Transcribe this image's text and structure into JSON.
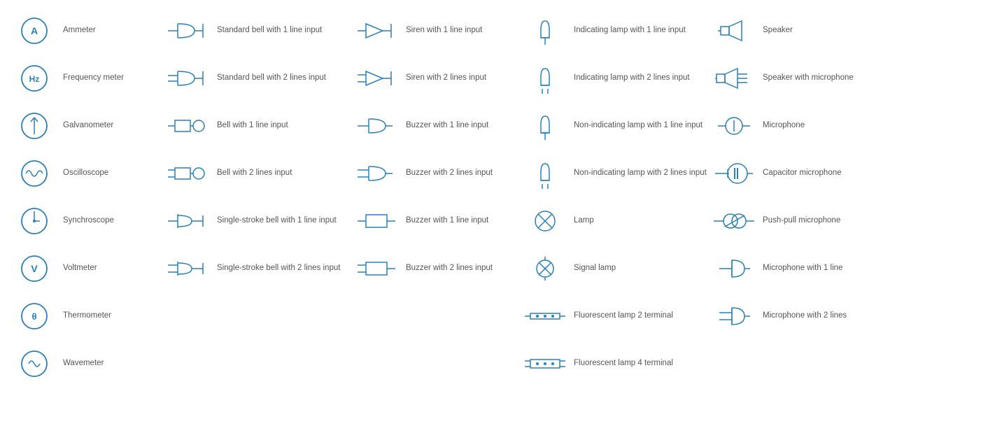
{
  "columns": [
    {
      "id": "meters",
      "items": [
        {
          "id": "ammeter",
          "label": "Ammeter",
          "symbol": "ammeter"
        },
        {
          "id": "frequency-meter",
          "label": "Frequency meter",
          "symbol": "frequency"
        },
        {
          "id": "galvanometer",
          "label": "Galvanometer",
          "symbol": "galvanometer"
        },
        {
          "id": "oscilloscope",
          "label": "Oscilloscope",
          "symbol": "oscilloscope"
        },
        {
          "id": "synchroscope",
          "label": "Synchroscope",
          "symbol": "synchroscope"
        },
        {
          "id": "voltmeter",
          "label": "Voltmeter",
          "symbol": "voltmeter"
        },
        {
          "id": "thermometer",
          "label": "Thermometer",
          "symbol": "thermometer"
        },
        {
          "id": "wavemeter",
          "label": "Wavemeter",
          "symbol": "wavemeter"
        }
      ]
    },
    {
      "id": "bells",
      "items": [
        {
          "id": "std-bell-1",
          "label": "Standard bell with 1 line input",
          "symbol": "std-bell-1"
        },
        {
          "id": "std-bell-2",
          "label": "Standard bell with 2 lines input",
          "symbol": "std-bell-2"
        },
        {
          "id": "bell-1",
          "label": "Bell with 1 line input",
          "symbol": "bell-1"
        },
        {
          "id": "bell-2",
          "label": "Bell with 2 lines input",
          "symbol": "bell-2"
        },
        {
          "id": "single-stroke-bell-1",
          "label": "Single-stroke bell with 1 line input",
          "symbol": "single-stroke-bell-1"
        },
        {
          "id": "single-stroke-bell-2",
          "label": "Single-stroke bell with 2 lines input",
          "symbol": "single-stroke-bell-2"
        }
      ]
    },
    {
      "id": "sirens",
      "items": [
        {
          "id": "siren-1",
          "label": "Siren with 1 line input",
          "symbol": "siren-1"
        },
        {
          "id": "siren-2",
          "label": "Siren with 2 lines input",
          "symbol": "siren-2"
        },
        {
          "id": "buzzer-1",
          "label": "Buzzer with 1 line input",
          "symbol": "buzzer-1"
        },
        {
          "id": "buzzer-2",
          "label": "Buzzer with 2 lines input",
          "symbol": "buzzer-2"
        },
        {
          "id": "buzzer-box-1",
          "label": "Buzzer with 1 line input",
          "symbol": "buzzer-box-1"
        },
        {
          "id": "buzzer-box-2",
          "label": "Buzzer with 2 lines input",
          "symbol": "buzzer-box-2"
        }
      ]
    },
    {
      "id": "lamps",
      "items": [
        {
          "id": "ind-lamp-1",
          "label": "Indicating lamp with 1 line input",
          "symbol": "ind-lamp-1"
        },
        {
          "id": "ind-lamp-2",
          "label": "Indicating lamp with 2 lines input",
          "symbol": "ind-lamp-2"
        },
        {
          "id": "non-ind-lamp-1",
          "label": "Non-indicating lamp with 1 line input",
          "symbol": "non-ind-lamp-1"
        },
        {
          "id": "non-ind-lamp-2",
          "label": "Non-indicating lamp with 2 lines input",
          "symbol": "non-ind-lamp-2"
        },
        {
          "id": "lamp",
          "label": "Lamp",
          "symbol": "lamp"
        },
        {
          "id": "signal-lamp",
          "label": "Signal lamp",
          "symbol": "signal-lamp"
        },
        {
          "id": "fluor-lamp-2",
          "label": "Fluorescent lamp 2 terminal",
          "symbol": "fluor-lamp-2"
        },
        {
          "id": "fluor-lamp-4",
          "label": "Fluorescent lamp 4 terminal",
          "symbol": "fluor-lamp-4"
        }
      ]
    },
    {
      "id": "speakers",
      "items": [
        {
          "id": "speaker",
          "label": "Speaker",
          "symbol": "speaker"
        },
        {
          "id": "speaker-mic",
          "label": "Speaker with microphone",
          "symbol": "speaker-mic"
        },
        {
          "id": "microphone",
          "label": "Microphone",
          "symbol": "microphone"
        },
        {
          "id": "capacitor-mic",
          "label": "Capacitor microphone",
          "symbol": "capacitor-mic"
        },
        {
          "id": "push-pull-mic",
          "label": "Push-pull microphone",
          "symbol": "push-pull-mic"
        },
        {
          "id": "mic-1",
          "label": "Microphone with 1 line",
          "symbol": "mic-1"
        },
        {
          "id": "mic-2",
          "label": "Microphone with 2 lines",
          "symbol": "mic-2"
        }
      ]
    }
  ]
}
